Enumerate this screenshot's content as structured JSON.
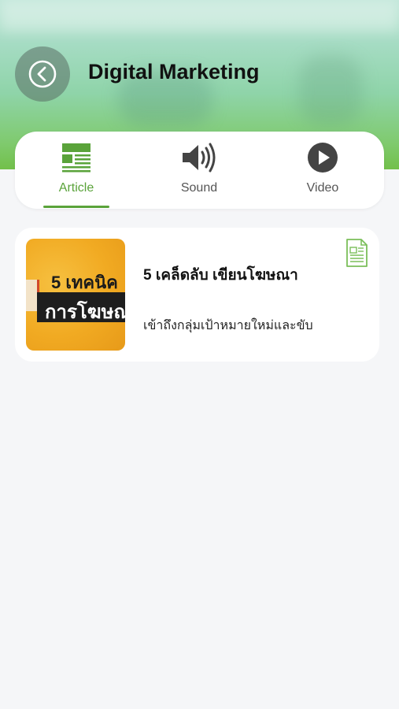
{
  "header": {
    "title": "Digital Marketing",
    "back_icon": "chevron-left-circle-icon"
  },
  "tabs": [
    {
      "label": "Article",
      "icon": "newspaper-icon",
      "active": true
    },
    {
      "label": "Sound",
      "icon": "speaker-icon",
      "active": false
    },
    {
      "label": "Video",
      "icon": "play-circle-icon",
      "active": false
    }
  ],
  "articles": [
    {
      "title": "5 เคล็ดลับ เขียนโฆษณา",
      "description": "เข้าถึงกลุ่มเป้าหมายใหม่และขับ",
      "thumbnail_text_top": "5 เทคนิค",
      "thumbnail_text_bottom": "การโฆษณ",
      "type_icon": "document-icon"
    }
  ],
  "colors": {
    "accent": "#5aa33a",
    "icon_dark": "#444444",
    "background": "#f5f6f8"
  }
}
